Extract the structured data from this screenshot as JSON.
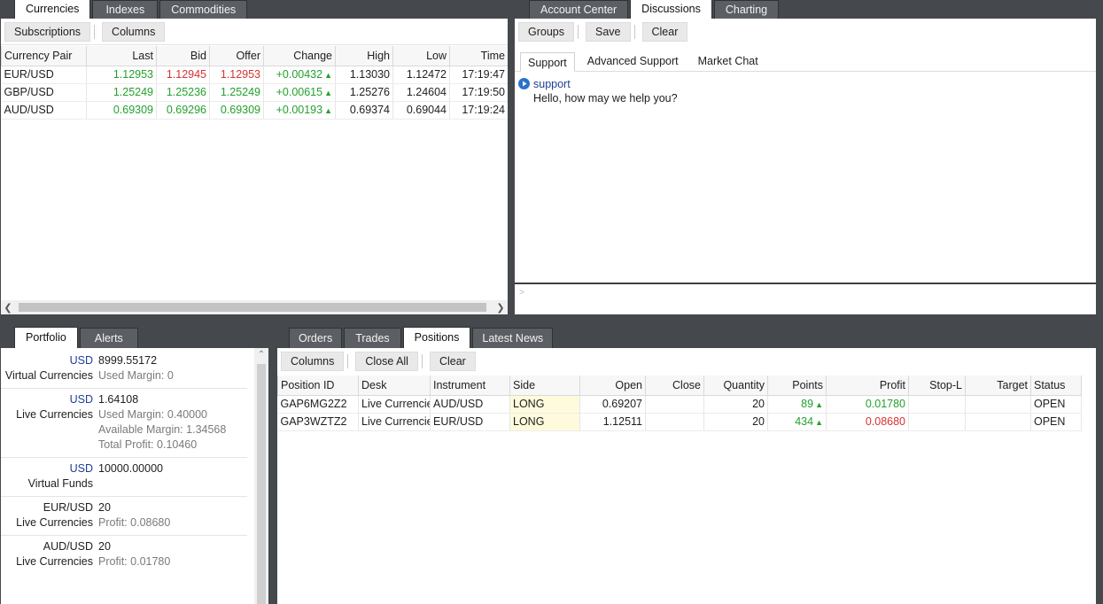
{
  "quotes": {
    "tabs": [
      {
        "label": "Currencies",
        "active": true
      },
      {
        "label": "Indexes",
        "active": false
      },
      {
        "label": "Commodities",
        "active": false
      }
    ],
    "toolbar": {
      "subscriptions": "Subscriptions",
      "columns": "Columns"
    },
    "columns": [
      "Currency Pair",
      "Last",
      "Bid",
      "Offer",
      "Change",
      "High",
      "Low",
      "Time"
    ],
    "rows": [
      {
        "pair": "EUR/USD",
        "last": "1.12953",
        "bid": "1.12945",
        "offer": "1.12953",
        "change": "+0.00432",
        "high": "1.13030",
        "low": "1.12472",
        "time": "17:19:47"
      },
      {
        "pair": "GBP/USD",
        "last": "1.25249",
        "bid": "1.25236",
        "offer": "1.25249",
        "change": "+0.00615",
        "high": "1.25276",
        "low": "1.24604",
        "time": "17:19:50"
      },
      {
        "pair": "AUD/USD",
        "last": "0.69309",
        "bid": "0.69296",
        "offer": "0.69309",
        "change": "+0.00193",
        "high": "0.69374",
        "low": "0.69044",
        "time": "17:19:24"
      }
    ],
    "up_glyph": "▲"
  },
  "discussions": {
    "tabs": [
      {
        "label": "Account Center",
        "active": false
      },
      {
        "label": "Discussions",
        "active": true
      },
      {
        "label": "Charting",
        "active": false
      }
    ],
    "toolbar": {
      "groups": "Groups",
      "save": "Save",
      "clear": "Clear"
    },
    "subtabs": [
      {
        "label": "Support",
        "active": true
      },
      {
        "label": "Advanced Support",
        "active": false
      },
      {
        "label": "Market Chat",
        "active": false
      }
    ],
    "message": {
      "sender": "support",
      "text": "Hello, how may we help you?"
    },
    "input_prompt": ">"
  },
  "portfolio": {
    "tabs": [
      {
        "label": "Portfolio",
        "active": true
      },
      {
        "label": "Alerts",
        "active": false
      }
    ],
    "items": [
      {
        "currency": "USD",
        "name": "Virtual Currencies",
        "value": "8999.55172",
        "details": [
          {
            "label": "Used Margin:",
            "value": "0"
          }
        ]
      },
      {
        "currency": "USD",
        "name": "Live Currencies",
        "value": "1.64108",
        "details": [
          {
            "label": "Used Margin:",
            "value": "0.40000"
          },
          {
            "label": "Available Margin:",
            "value": "1.34568"
          },
          {
            "label": "Total Profit:",
            "value": "0.10460"
          }
        ]
      },
      {
        "currency": "USD",
        "name": "Virtual Funds",
        "value": "10000.00000",
        "details": []
      },
      {
        "currency": "EUR/USD",
        "name": "Live Currencies",
        "value": "20",
        "details": [
          {
            "label": "Profit:",
            "value": "0.08680"
          }
        ]
      },
      {
        "currency": "AUD/USD",
        "name": "Live Currencies",
        "value": "20",
        "details": [
          {
            "label": "Profit:",
            "value": "0.01780"
          }
        ]
      }
    ]
  },
  "positions": {
    "tabs": [
      {
        "label": "Orders",
        "active": false
      },
      {
        "label": "Trades",
        "active": false
      },
      {
        "label": "Positions",
        "active": true
      },
      {
        "label": "Latest News",
        "active": false
      }
    ],
    "toolbar": {
      "columns": "Columns",
      "close_all": "Close All",
      "clear": "Clear"
    },
    "columns": [
      "Position ID",
      "Desk",
      "Instrument",
      "Side",
      "Open",
      "Close",
      "Quantity",
      "Points",
      "Profit",
      "Stop-L",
      "Target",
      "Status"
    ],
    "rows": [
      {
        "id": "GAP6MG2Z2",
        "desk": "Live Currencies",
        "instrument": "AUD/USD",
        "side": "LONG",
        "open": "0.69207",
        "close": "",
        "quantity": "20",
        "points": "89",
        "profit": "0.01780",
        "profit_color": "green",
        "stop": "",
        "target": "",
        "status": "OPEN"
      },
      {
        "id": "GAP3WZTZ2",
        "desk": "Live Currencies",
        "instrument": "EUR/USD",
        "side": "LONG",
        "open": "1.12511",
        "close": "",
        "quantity": "20",
        "points": "434",
        "profit": "0.08680",
        "profit_color": "red",
        "stop": "",
        "target": "",
        "status": "OPEN"
      }
    ],
    "up_glyph": "▲"
  },
  "colors": {
    "up": "#23a12c",
    "down": "#d63232",
    "currency_label": "#1f3d97",
    "side_highlight": "#fdfbdc"
  }
}
